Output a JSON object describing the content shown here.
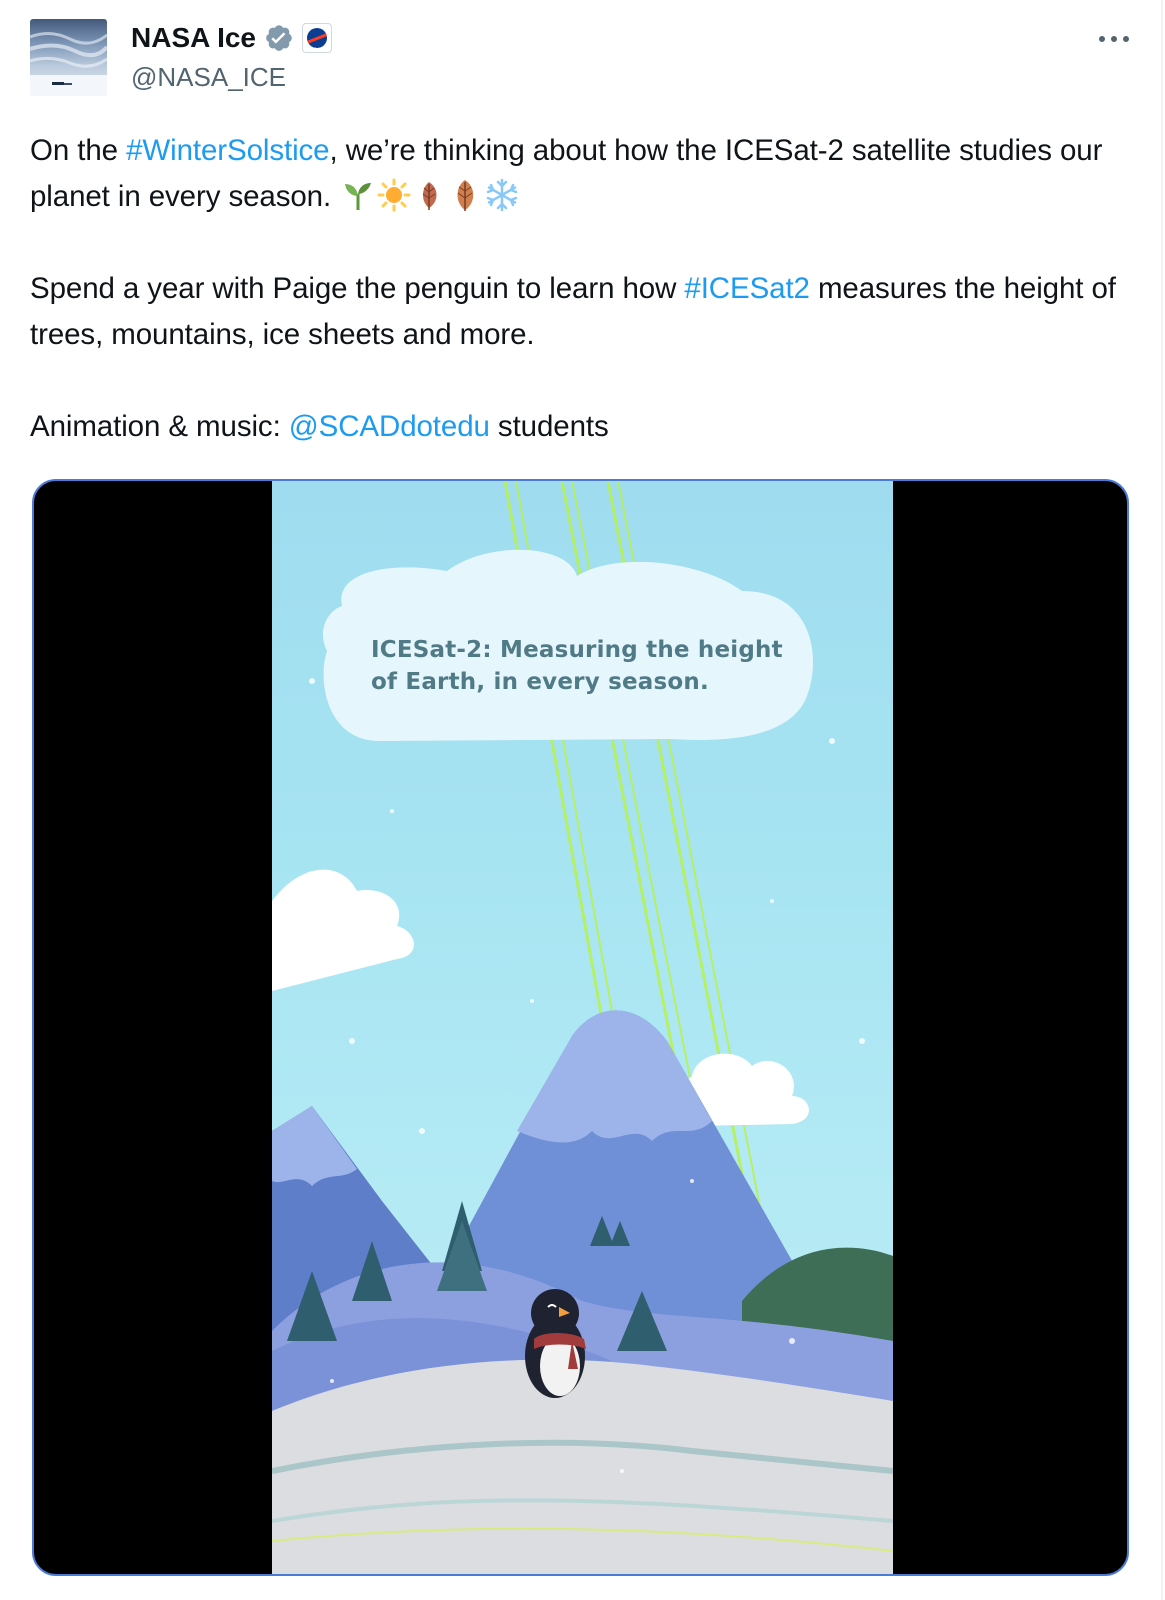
{
  "author": {
    "display_name": "NASA Ice",
    "handle": "@NASA_ICE",
    "verified_icon": "verified-badge-icon",
    "affiliate_badge_icon": "nasa-meatball-icon"
  },
  "menu": {
    "more_icon": "more-horizontal-icon"
  },
  "tweet": {
    "p1": {
      "before": "On the ",
      "hashtag": "#WinterSolstice",
      "after": ",  we’re thinking about how the ICESat-2 satellite studies our planet in every season. ",
      "emojis": [
        "seedling-icon",
        "sun-icon",
        "fallen-leaf-icon",
        "fallen-leaf-icon",
        "snowflake-icon"
      ]
    },
    "p2": {
      "before": "Spend a year with Paige the penguin to learn how ",
      "hashtag": "#ICESat2",
      "after": " measures the height of trees, mountains, ice sheets and more."
    },
    "p3": {
      "before": "Animation & music: ",
      "mention": "@SCADdotedu",
      "after": " students"
    }
  },
  "media": {
    "caption": "ICESat-2: Measuring the height of Earth, in every season."
  },
  "colors": {
    "link": "#1d9bf0",
    "text": "#0f1419",
    "secondary": "#536471",
    "media_border": "#4a7bd6"
  }
}
